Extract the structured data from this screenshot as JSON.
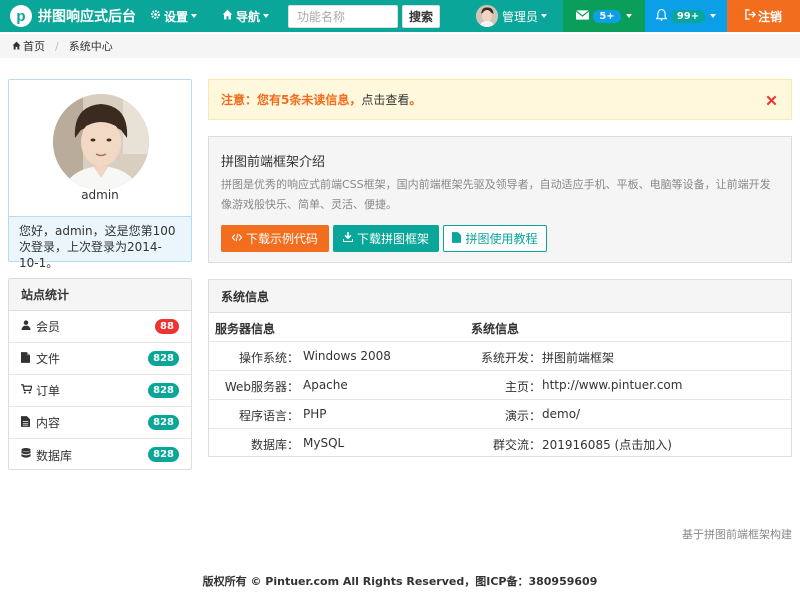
{
  "app": {
    "logo_letter": "p",
    "title": "拼图响应式后台"
  },
  "nav": {
    "settings": "设置",
    "navigation": "导航"
  },
  "search": {
    "placeholder": "功能名称",
    "button": "搜索"
  },
  "user": {
    "name": "管理员"
  },
  "mail": {
    "count": "5+"
  },
  "notifications": {
    "count": "99+"
  },
  "logout": "注销",
  "breadcrumb": {
    "home": "首页",
    "current": "系统中心"
  },
  "profile": {
    "name": "admin",
    "welcome": "您好，admin，这是您第100次登录，上次登录为2014-10-1。"
  },
  "stats": {
    "title": "站点统计",
    "items": [
      {
        "label": "会员",
        "value": "88",
        "icon": "user-icon",
        "color": "#ee3333"
      },
      {
        "label": "文件",
        "value": "828",
        "icon": "file-icon",
        "color": "#0aa699"
      },
      {
        "label": "订单",
        "value": "828",
        "icon": "cart-icon",
        "color": "#0aa699"
      },
      {
        "label": "内容",
        "value": "828",
        "icon": "file-text-icon",
        "color": "#0aa699"
      },
      {
        "label": "数据库",
        "value": "828",
        "icon": "database-icon",
        "color": "#0aa699"
      }
    ]
  },
  "notice": {
    "highlight": "注意：您有5条未读信息，",
    "text": "点击查看",
    "end": "。"
  },
  "intro": {
    "title": "拼图前端框架介绍",
    "text": "拼图是优秀的响应式前端CSS框架，国内前端框架先驱及领导者，自动适应手机、平板、电脑等设备，让前端开发像游戏般快乐、简单、灵活、便捷。",
    "btn_demo": "下载示例代码",
    "btn_download": "下载拼图框架",
    "btn_tutorial": "拼图使用教程"
  },
  "sysinfo": {
    "title": "系统信息",
    "col1_header": "服务器信息",
    "col2_header": "系统信息",
    "rows": [
      {
        "k1": "操作系统：",
        "v1": "Windows 2008",
        "k2": "系统开发：",
        "v2": "拼图前端框架"
      },
      {
        "k1": "Web服务器：",
        "v1": "Apache",
        "k2": "主页：",
        "v2": "http://www.pintuer.com"
      },
      {
        "k1": "程序语言：",
        "v1": "PHP",
        "k2": "演示：",
        "v2": "demo/"
      },
      {
        "k1": "数据库：",
        "v1": "MySQL",
        "k2": "群交流：",
        "v2": "201916085 (点击加入)"
      }
    ]
  },
  "built_by": "基于拼图前端框架构建",
  "footer": "版权所有 © Pintuer.com All Rights Reserved，图ICP备：380959609",
  "colors": {
    "brand": "#0aa699",
    "orange": "#f26d1e",
    "blue": "#0b9fe8",
    "green": "#0a9e5a",
    "red": "#ee3333"
  }
}
